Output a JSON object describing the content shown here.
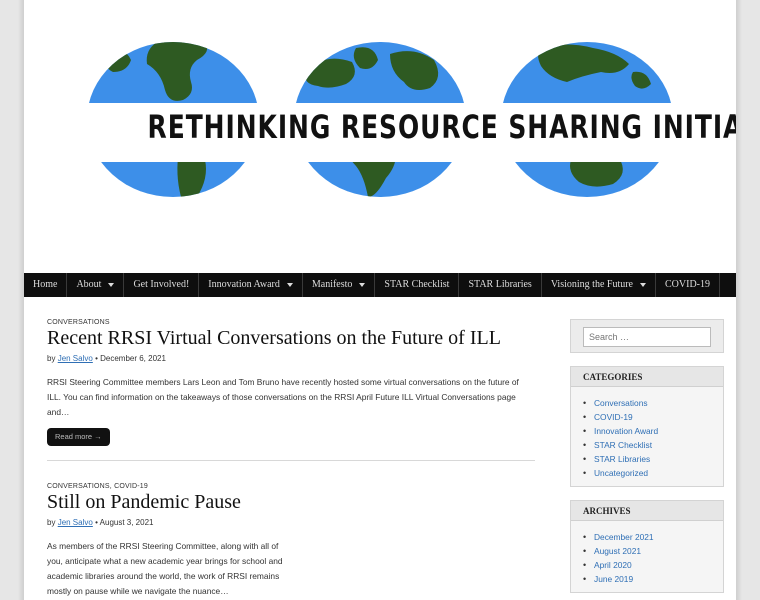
{
  "site": {
    "title": "RETHINKING RESOURCE SHARING INITIATIVE"
  },
  "nav": [
    {
      "label": "Home",
      "dropdown": false
    },
    {
      "label": "About",
      "dropdown": true
    },
    {
      "label": "Get Involved!",
      "dropdown": false
    },
    {
      "label": "Innovation Award",
      "dropdown": true
    },
    {
      "label": "Manifesto",
      "dropdown": true
    },
    {
      "label": "STAR Checklist",
      "dropdown": false
    },
    {
      "label": "STAR Libraries",
      "dropdown": false
    },
    {
      "label": "Visioning the Future",
      "dropdown": true
    },
    {
      "label": "COVID-19",
      "dropdown": false
    }
  ],
  "posts": [
    {
      "categories": [
        "CONVERSATIONS"
      ],
      "title": "Recent RRSI Virtual Conversations on the Future of ILL",
      "by": "by",
      "author": "Jen Salvo",
      "date": "December 6, 2021",
      "excerpt": "RRSI Steering Committee members Lars Leon and Tom Bruno have recently hosted some virtual conversations on the future of ILL. You can find information on the takeaways of those conversations on the RRSI April Future ILL Virtual Conversations page and…",
      "read_more": "Read more →"
    },
    {
      "categories": [
        "CONVERSATIONS",
        "COVID-19"
      ],
      "title": "Still on Pandemic Pause",
      "by": "by",
      "author": "Jen Salvo",
      "date": "August 3, 2021",
      "excerpt": "As members of the RRSI Steering Committee, along with all of you, anticipate what a new academic year brings for school and academic libraries around the world, the work of RRSI remains mostly on pause while we navigate the nuance…"
    }
  ],
  "sidebar": {
    "search_placeholder": "Search …",
    "categories_title": "CATEGORIES",
    "categories": [
      "Conversations",
      "COVID-19",
      "Innovation Award",
      "STAR Checklist",
      "STAR Libraries",
      "Uncategorized"
    ],
    "archives_title": "ARCHIVES",
    "archives": [
      "December 2021",
      "August 2021",
      "April 2020",
      "June 2019"
    ]
  },
  "colors": {
    "ocean": "#3d8fe9",
    "land": "#2e5a22",
    "nav_bg": "#0e0e0e",
    "link": "#2f6fb5"
  },
  "icons": [
    "globe-americas-icon",
    "globe-africa-icon",
    "globe-asia-icon",
    "dropdown-caret-icon"
  ]
}
